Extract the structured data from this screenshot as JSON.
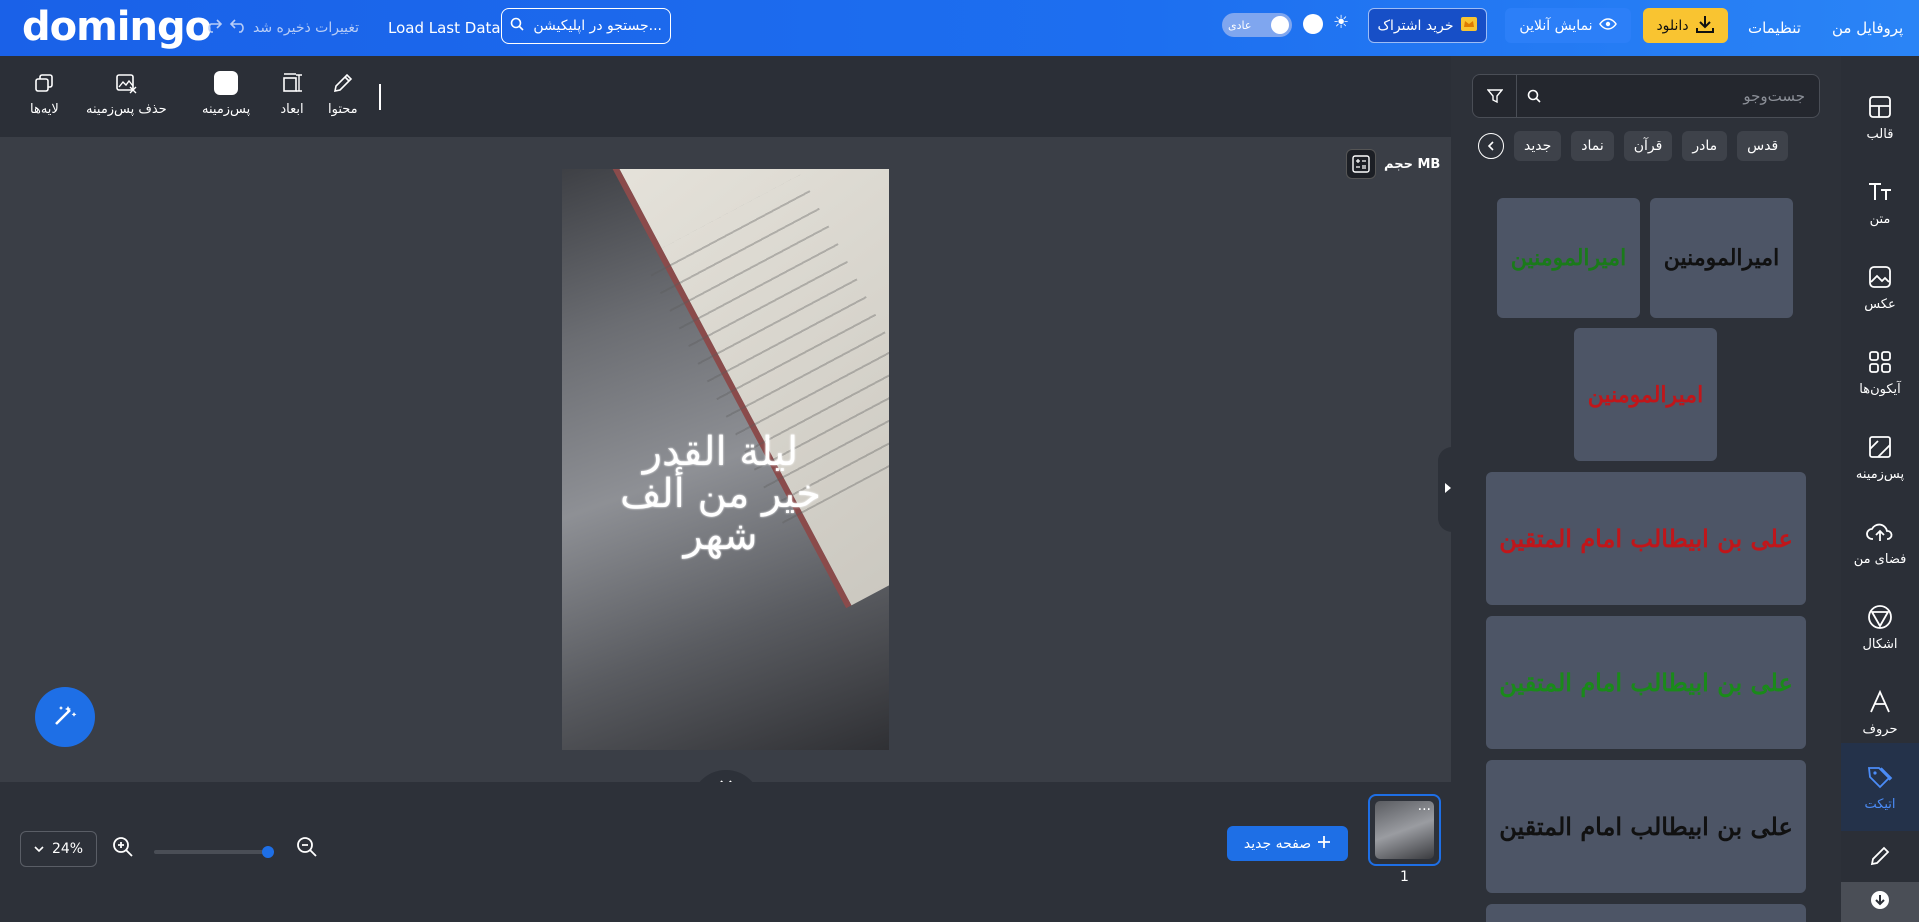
{
  "header": {
    "logo": "domingo",
    "saved_status": "تغییرات ذخیره شد",
    "load_last": "Load Last Data",
    "search_placeholder": "جستجو در اپلیکیشن...",
    "theme_label": "عادی",
    "subscribe": "خرید اشتراک",
    "online_view": "نمایش آنلاین",
    "download": "دانلود",
    "settings": "تنظیمات",
    "profile": "پروفایل من"
  },
  "toolbar": {
    "content": "محتوا",
    "dimensions": "ابعاد",
    "background": "پس‌زمینه",
    "remove_bg": "حذف پس‌زمینه",
    "layers": "لایه‌ها"
  },
  "canvas": {
    "size_label": "حجم MB",
    "calligraphy": "لیلة القدر خیر من ألف شهر"
  },
  "bottom": {
    "zoom": "24%",
    "new_page": "صفحه جدید",
    "page_number": "1"
  },
  "panel": {
    "search_placeholder": "جست‌وجو",
    "chips": [
      "قدس",
      "مادر",
      "قرآن",
      "نماد",
      "جدید"
    ],
    "stickers": [
      {
        "text": "امیرالمومنین",
        "color": "#111111"
      },
      {
        "text": "امیرالمومنین",
        "color": "#1a7a1a"
      },
      {
        "text": "امیرالمومنین",
        "color": "#c0161a"
      },
      {
        "text": "علی بن ابیطالب امام المتقین",
        "color": "#c0161a"
      },
      {
        "text": "علی بن ابیطالب امام المتقین",
        "color": "#1a8a1a"
      },
      {
        "text": "علی بن ابیطالب امام المتقین",
        "color": "#111111"
      }
    ]
  },
  "sidebar": {
    "items": [
      {
        "label": "قالب",
        "icon": "template-icon"
      },
      {
        "label": "متن",
        "icon": "text-icon"
      },
      {
        "label": "عکس",
        "icon": "image-icon"
      },
      {
        "label": "آیکون‌ها",
        "icon": "grid-icon"
      },
      {
        "label": "پس‌زمینه",
        "icon": "background-icon"
      },
      {
        "label": "فضای من",
        "icon": "cloud-upload-icon"
      },
      {
        "label": "اشکال",
        "icon": "shapes-icon"
      },
      {
        "label": "حروف",
        "icon": "font-icon"
      },
      {
        "label": "اتیکت",
        "icon": "tag-icon"
      }
    ]
  },
  "colors": {
    "accent": "#1e6fe6",
    "download_btn": "#f9c431"
  }
}
